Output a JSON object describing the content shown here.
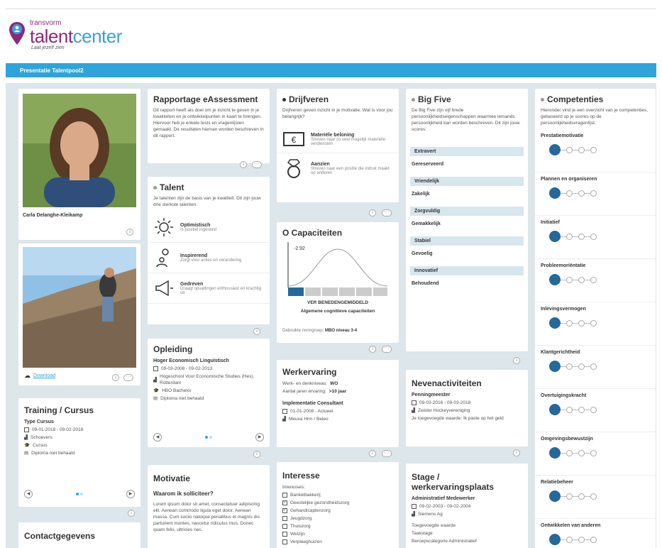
{
  "logo": {
    "small": "transvorm",
    "big_a": "talent",
    "big_b": "center",
    "tag": "Laat jezelf zien"
  },
  "bar": {
    "title": "Presentatie Talentpool2"
  },
  "profile": {
    "name": "Carla Delanghe-Kleikamp"
  },
  "photo2": {
    "download": "Download"
  },
  "training": {
    "title": "Training / Cursus",
    "item_title": "Type Cursus",
    "dates": "09-01-2018 - 09-02-2018",
    "org": "Schoevers",
    "type": "Cursus",
    "diploma": "Diploma niet behaald"
  },
  "contact": {
    "title": "Contactgegevens"
  },
  "rapport": {
    "title": "Rapportage eAssessment",
    "text": "Dit rapport heeft als doel om je inzicht te geven in je kwaliteiten en je ontwikkelpunten in kaart te brengen. Hiervoor heb je enkele tests en vragenlijsten gemaakt. De resultaten hiervan worden beschreven in dit rapport."
  },
  "talent": {
    "title": "Talent",
    "text": "Je talenten zijn de basis van je kwaliteit. Dit zijn jouw drie sterkste talenten:",
    "items": [
      {
        "name": "Optimistisch",
        "desc": "Is positief ingesteld"
      },
      {
        "name": "Inspirerend",
        "desc": "Zorgt voor acties en verandering"
      },
      {
        "name": "Gedreven",
        "desc": "Draagt opvattingen enthousiast en krachtig uit"
      }
    ]
  },
  "opleiding": {
    "title": "Opleiding",
    "item_title": "Hoger Economisch Linguïstisch",
    "dates": "09-03-2008 - 09-02-2013",
    "school": "Hogeschool Voor Economische Studies (Hes), Rotterdam",
    "level": "HBO Bachelor",
    "diploma": "Diploma niet behaald"
  },
  "motivatie": {
    "title": "Motivatie",
    "sub": "Waarom ik solliciteer?",
    "text": "Lorem ipsum dolor sit amet, consectetuer adipiscing elit. Aenean commodo ligula eget dolor. Aenean massa. Cum sociis natoque penatibus et magnis dis parturient montes, nascetur ridiculus mus. Donec quam felis, ultricies nec."
  },
  "drijfveren": {
    "title": "Drijfveren",
    "text": "Drijfveren geven inzicht in je motivatie. Wat is voor jou belangrijk?",
    "items": [
      {
        "name": "Materiële beloning",
        "desc": "Streven naar zo veel mogelijk materiële verdiensten"
      },
      {
        "name": "Aanzien",
        "desc": "Streven naar een positie die indruk maakt op anderen"
      }
    ]
  },
  "capaciteiten": {
    "title": "Capaciteiten",
    "value": "-2.92",
    "band": "VER BENEDENGEMIDDELD",
    "label": "Algemene cognitieve capaciteiten",
    "norm_prefix": "Gebruikte normgroep:",
    "norm": "MBO niveau 3-4"
  },
  "werkervaring": {
    "title": "Werkervaring",
    "l1_prefix": "Werk- en denkniveau:",
    "l1": "WO",
    "l2_prefix": "Aantal jaren ervaring:",
    "l2": ">10 jaar",
    "job": "Implementatie Consultant",
    "dates": "01-01-2008 - Actueel",
    "org": "Meuva Hrm / Beleo"
  },
  "interesse": {
    "title": "Interesse",
    "label": "Interesses:",
    "items": [
      {
        "t": "Banketbakkerij",
        "c": false
      },
      {
        "t": "Geestelijke gezondheidszorg",
        "c": true
      },
      {
        "t": "Gehandicaptenzorg",
        "c": true
      },
      {
        "t": "Jeugdzorg",
        "c": false
      },
      {
        "t": "Thuiszorg",
        "c": false
      },
      {
        "t": "Welzijn",
        "c": false
      },
      {
        "t": "Verpleeghuizen",
        "c": false
      }
    ]
  },
  "bigfive": {
    "title": "Big Five",
    "text": "De Big Five zijn vijf brede persoonlijkheidseigenschappen waarmee iemands persoonlijkheid kan worden beschreven. Dit zijn jouw scores:",
    "items": [
      {
        "h": "Extravert",
        "v": "Gereserveerd"
      },
      {
        "h": "Vriendelijk",
        "v": "Zakelijk"
      },
      {
        "h": "Zorgvuldig",
        "v": "Gemakkelijk"
      },
      {
        "h": "Stabiel",
        "v": "Gevoelig"
      },
      {
        "h": "Innovatief",
        "v": "Behoudend"
      }
    ]
  },
  "nevenact": {
    "title": "Nevenactiviteiten",
    "role": "Penningmeester",
    "dates": "09-03-2016 - 09-03-2018",
    "org": "Zeister Hockeyvereniging",
    "text": "Je toegevoegde waarde: Ik paste op het geld"
  },
  "stage": {
    "title": "Stage / werkervaringsplaats",
    "role": "Administratief Medewerker",
    "dates": "09-02-2003 - 09-02-2004",
    "org": "Siemens Ag",
    "l1": "Toegevoegde waarde",
    "l2": "Taakstage",
    "l3": "Beroepscategorie Administratief"
  },
  "competenties": {
    "title": "Competenties",
    "text": "Hieronder vind je een overzicht van je competenties, gebaseerd op je scores op de persoonlijkheidsvragenlijst.",
    "items": [
      {
        "label": "Prestatiemotivatie",
        "level": 1
      },
      {
        "label": "Plannen en organiseren",
        "level": 1
      },
      {
        "label": "Initiatief",
        "level": 1
      },
      {
        "label": "Probleemoriëntatie",
        "level": 1
      },
      {
        "label": "Inlevingsvermogen",
        "level": 1
      },
      {
        "label": "Klantgerichtheid",
        "level": 1
      },
      {
        "label": "Overtuigingskracht",
        "level": 1
      },
      {
        "label": "Omgevingsbewustzijn",
        "level": 1
      },
      {
        "label": "Relatiebeheer",
        "level": 1
      },
      {
        "label": "Ontwikkelen van anderen",
        "level": 1
      }
    ]
  },
  "colors": {
    "accent": "#2fa4db",
    "brand": "#8c2a7a",
    "dark_dot": "#24699a",
    "bg": "#dde6ea"
  }
}
